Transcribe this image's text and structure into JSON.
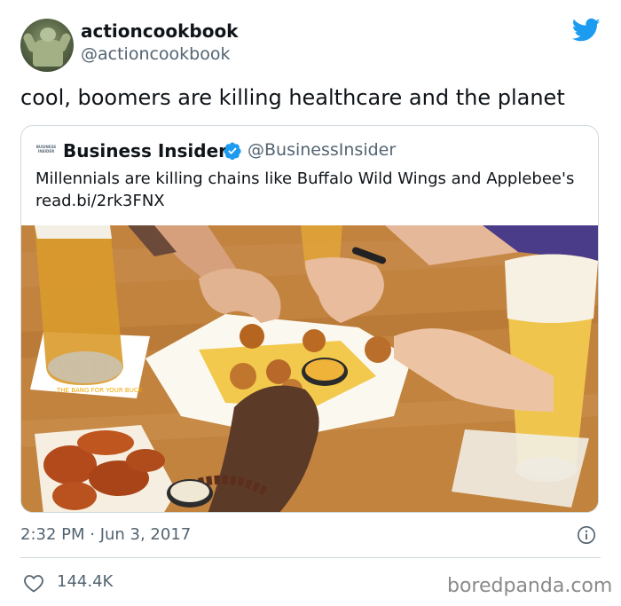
{
  "tweet": {
    "display_name": "actioncookbook",
    "handle": "@actioncookbook",
    "text": "cool, boomers are killing healthcare and the planet",
    "timestamp": "2:32 PM · Jun 3, 2017",
    "likes": "144.4K"
  },
  "quoted_tweet": {
    "logo_text": "BUSINESS INSIDER",
    "display_name": "Business Insider",
    "handle": "@BusinessInsider",
    "text": "Millennials are killing chains like Buffalo Wild Wings and Applebee's read.bi/2rk3FNX",
    "coaster_text": "THE BANG FOR YOUR BUCK"
  },
  "watermark": "boredpanda.com",
  "icons": {
    "brand": "twitter-bird-icon",
    "verified": "verified-badge-icon",
    "info": "info-icon",
    "like": "heart-icon"
  },
  "colors": {
    "twitter_blue": "#1d9bf0",
    "text": "#0f1419",
    "secondary_text": "#536471",
    "border": "#cfd9de"
  }
}
